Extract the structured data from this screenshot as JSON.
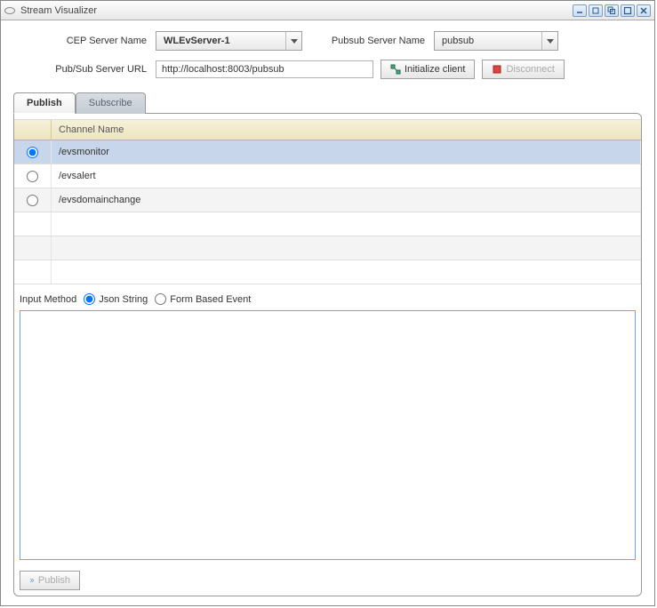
{
  "window": {
    "title": "Stream Visualizer"
  },
  "form": {
    "cep_label": "CEP Server Name",
    "cep_value": "WLEvServer-1",
    "pubsub_name_label": "Pubsub Server Name",
    "pubsub_name_value": "pubsub",
    "url_label": "Pub/Sub Server URL",
    "url_value": "http://localhost:8003/pubsub",
    "init_btn": "Initialize client",
    "disconnect_btn": "Disconnect"
  },
  "tabs": {
    "publish": "Publish",
    "subscribe": "Subscribe"
  },
  "grid": {
    "header": "Channel Name",
    "rows": [
      {
        "name": "/evsmonitor",
        "selected": true
      },
      {
        "name": "/evsalert",
        "selected": false
      },
      {
        "name": "/evsdomainchange",
        "selected": false
      }
    ]
  },
  "input_method": {
    "label": "Input Method",
    "json": "Json String",
    "form": "Form Based Event"
  },
  "textarea_value": "",
  "publish_btn": "Publish"
}
